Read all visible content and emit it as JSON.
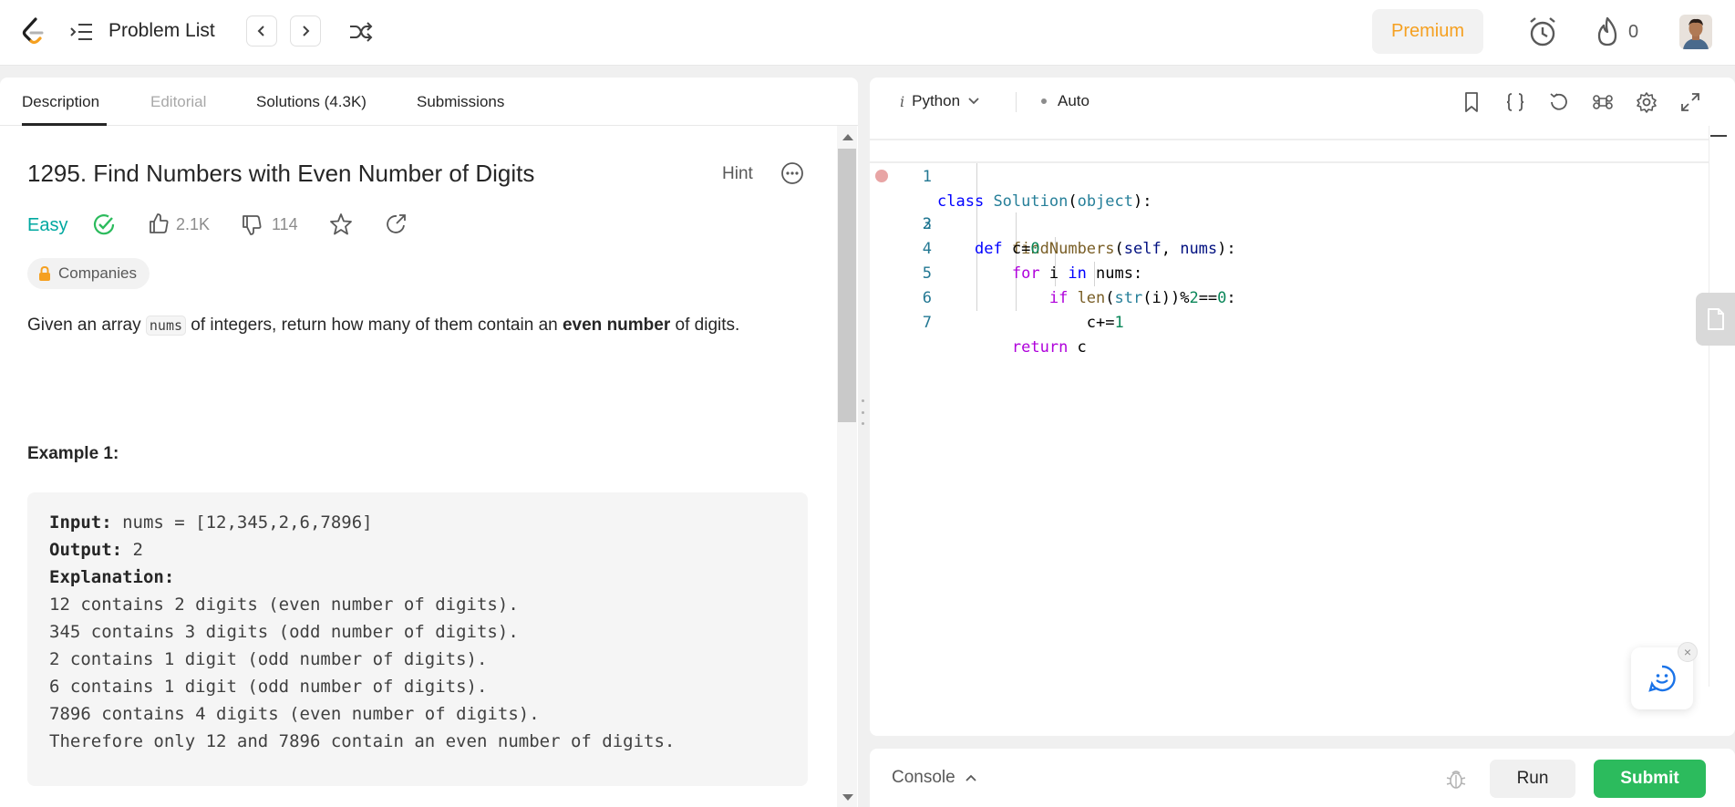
{
  "nav": {
    "problem_list_label": "Problem List",
    "premium_label": "Premium",
    "streak_count": "0"
  },
  "tabs": [
    {
      "label": "Description"
    },
    {
      "label": "Editorial"
    },
    {
      "label": "Solutions (4.3K)"
    },
    {
      "label": "Submissions"
    }
  ],
  "problem": {
    "title": "1295. Find Numbers with Even Number of Digits",
    "hint_label": "Hint",
    "difficulty": "Easy",
    "likes": "2.1K",
    "dislikes": "114",
    "companies_label": "Companies",
    "desc_pre": "Given an array ",
    "desc_code": "nums",
    "desc_mid": " of integers, return how many of them contain an ",
    "desc_bold": "even number",
    "desc_post": " of digits.",
    "example_title": "Example 1:",
    "example": {
      "input_label": "Input:",
      "input_value": " nums = [12,345,2,6,7896]",
      "output_label": "Output:",
      "output_value": " 2",
      "explanation_label": "Explanation:",
      "explanation_lines": [
        "12 contains 2 digits (even number of digits).",
        "345 contains 3 digits (odd number of digits).",
        "2 contains 1 digit (odd number of digits).",
        "6 contains 1 digit (odd number of digits).",
        "7896 contains 4 digits (even number of digits).",
        "Therefore only 12 and 7896 contain an even number of digits."
      ]
    }
  },
  "editor": {
    "language": "Python",
    "mode": "Auto",
    "line_numbers": [
      "1",
      "2",
      "3",
      "4",
      "5",
      "6",
      "7"
    ]
  },
  "console": {
    "label": "Console",
    "run_label": "Run",
    "submit_label": "Submit"
  },
  "colors": {
    "accent_premium": "#f5a020",
    "easy": "#00a8a0",
    "submit": "#2cbb5d"
  }
}
